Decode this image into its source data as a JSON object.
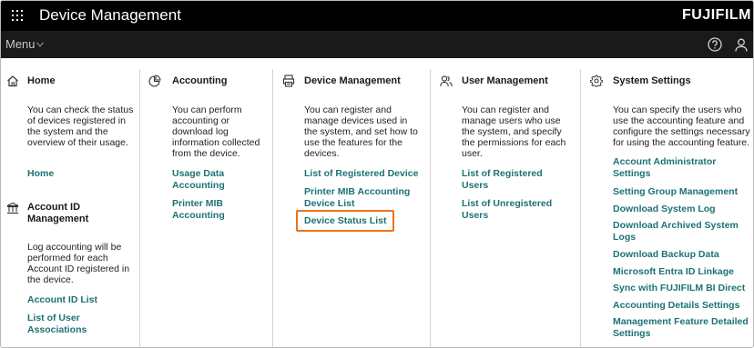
{
  "header": {
    "title": "Device Management",
    "brand": "FUJIFILM"
  },
  "menubar": {
    "menu_label": "Menu"
  },
  "columns": {
    "home": {
      "heading": "Home",
      "description": "You can check the status of devices registered in the system and the overview of their usage.",
      "links": [
        "Home"
      ]
    },
    "account_id": {
      "heading": "Account ID Management",
      "description": "Log accounting will be performed for each Account ID registered in the device.",
      "links": [
        "Account ID List",
        "List of User Associations"
      ]
    },
    "accounting": {
      "heading": "Accounting",
      "description": "You can perform accounting or download log information collected from the device.",
      "links": [
        "Usage Data Accounting",
        "Printer MIB Accounting"
      ]
    },
    "device_management": {
      "heading": "Device Management",
      "description": "You can register and manage devices used in the system, and set how to use the features for the devices.",
      "links": [
        "List of Registered Device",
        "Printer MIB Accounting Device List",
        "Device Status List"
      ]
    },
    "user_management": {
      "heading": "User Management",
      "description": "You can register and manage users who use the system, and specify the permissions for each user.",
      "links": [
        "List of Registered Users",
        "List of Unregistered Users"
      ]
    },
    "system_settings": {
      "heading": "System Settings",
      "description": "You can specify the users who use the accounting feature and configure the settings necessary for using the accounting feature.",
      "links": [
        "Account Administrator Settings",
        "Setting Group Management",
        "Download System Log",
        "Download Archived System Logs",
        "Download Backup Data",
        "Microsoft Entra ID Linkage",
        "Sync with FUJIFILM BI Direct",
        "Accounting Details Settings",
        "Management Feature Detailed Settings"
      ]
    }
  },
  "colors": {
    "link": "#1c7275",
    "highlight": "#f07218",
    "topbar": "#000000",
    "menubar": "#1a1a1a"
  },
  "icons": {
    "apps": "grid-icon",
    "help": "help-icon",
    "user": "user-icon",
    "home": "home-icon",
    "account_id": "bank-icon",
    "accounting": "pie-chart-icon",
    "device": "printer-icon",
    "users": "users-icon",
    "settings": "gear-icon"
  }
}
